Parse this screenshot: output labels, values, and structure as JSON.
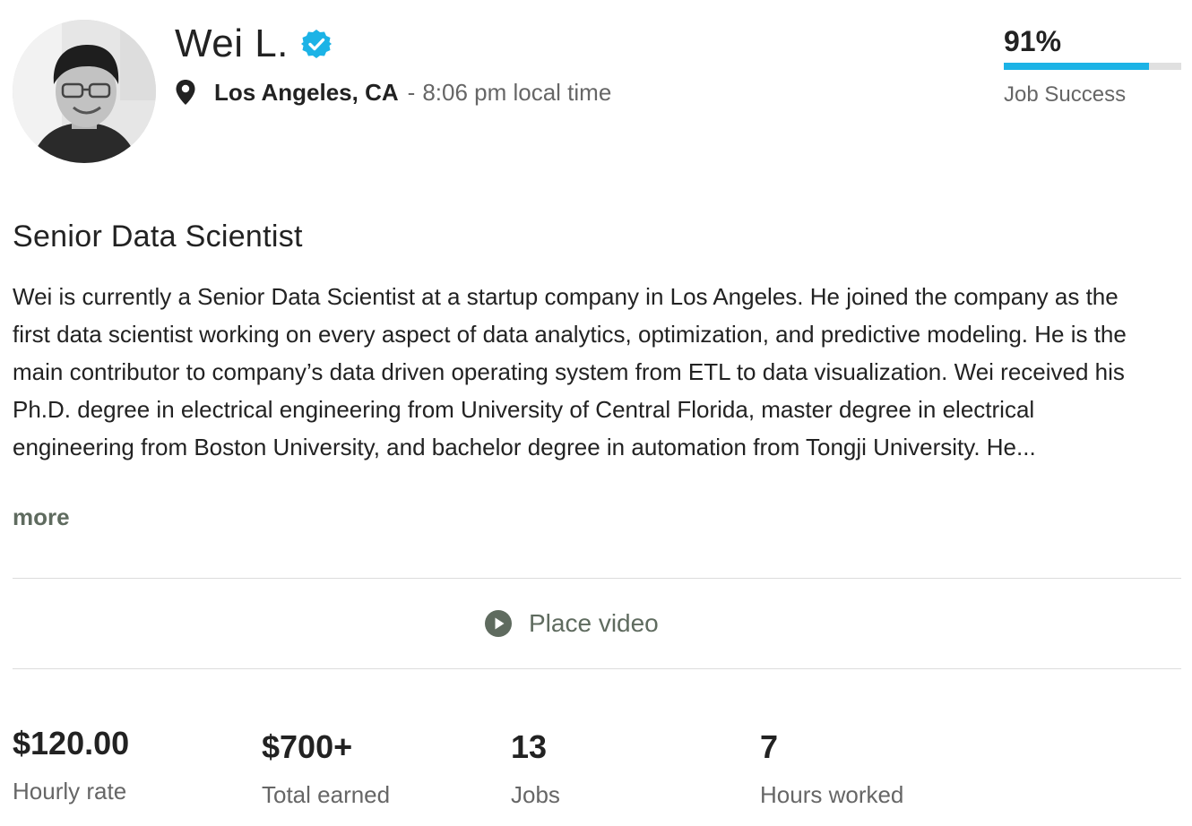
{
  "profile": {
    "name": "Wei L.",
    "location": "Los Angeles, CA",
    "separator": "-",
    "local_time": "8:06 pm local time",
    "avatar_icon": "avatar-photo"
  },
  "job_success": {
    "value": "91%",
    "fraction": 0.91,
    "label": "Job Success",
    "bar_color": "#1cb3e6"
  },
  "overview": {
    "title": "Senior Data Scientist",
    "bio": "Wei is currently a Senior Data Scientist at a startup company in Los Angeles. He joined the company as the first data scientist working on every aspect of data analytics, optimization, and predictive modeling. He is the main contributor to company’s data driven operating system from ETL to data visualization. Wei received his Ph.D. degree in electrical engineering from University of Central Florida, master degree in electrical engineering from Boston University, and bachelor degree in automation from Tongji University. He...",
    "more_label": "more"
  },
  "video": {
    "label": "Place video",
    "icon": "play-icon"
  },
  "stats": [
    {
      "value": "$120.00",
      "label": "Hourly rate"
    },
    {
      "value": "$700+",
      "label": "Total earned"
    },
    {
      "value": "13",
      "label": "Jobs"
    },
    {
      "value": "7",
      "label": "Hours worked"
    }
  ],
  "colors": {
    "verified": "#1cb3e6",
    "muted": "#666666",
    "link": "#5f6b5f"
  }
}
